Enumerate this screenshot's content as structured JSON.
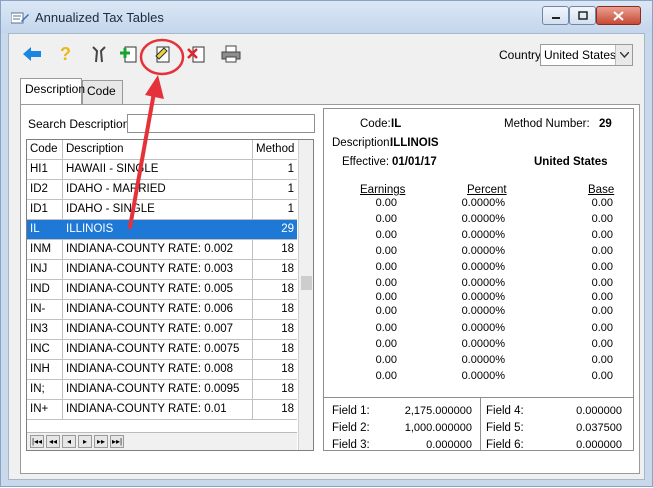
{
  "window": {
    "title": "Annualized Tax Tables"
  },
  "toolbar": {
    "buttons": [
      {
        "name": "back-arrow-icon"
      },
      {
        "name": "help-icon"
      },
      {
        "name": "tools-icon"
      },
      {
        "name": "add-icon"
      },
      {
        "name": "edit-icon"
      },
      {
        "name": "delete-icon"
      },
      {
        "name": "print-icon"
      }
    ],
    "country_label": "Country",
    "country_value": "United States"
  },
  "tabs": [
    {
      "label": "Description"
    },
    {
      "label": "Code"
    }
  ],
  "search": {
    "label": "Search Description",
    "value": ""
  },
  "grid": {
    "headers": [
      "Code",
      "Description",
      "Method"
    ],
    "rows": [
      [
        "HI1",
        "HAWAII - SINGLE",
        "1"
      ],
      [
        "ID2",
        "IDAHO - MARRIED",
        "1"
      ],
      [
        "ID1",
        "IDAHO - SINGLE",
        "1"
      ],
      [
        "IL",
        "ILLINOIS",
        "29"
      ],
      [
        "INM",
        "INDIANA-COUNTY RATE: 0.002",
        "18"
      ],
      [
        "INJ",
        "INDIANA-COUNTY RATE: 0.003",
        "18"
      ],
      [
        "IND",
        "INDIANA-COUNTY RATE: 0.005",
        "18"
      ],
      [
        "IN-",
        "INDIANA-COUNTY RATE: 0.006",
        "18"
      ],
      [
        "IN3",
        "INDIANA-COUNTY RATE: 0.007",
        "18"
      ],
      [
        "INC",
        "INDIANA-COUNTY RATE: 0.0075",
        "18"
      ],
      [
        "INH",
        "INDIANA-COUNTY RATE: 0.008",
        "18"
      ],
      [
        "IN;",
        "INDIANA-COUNTY RATE: 0.0095",
        "18"
      ],
      [
        "IN+",
        "INDIANA-COUNTY RATE: 0.01",
        "18"
      ]
    ],
    "selected_index": 3,
    "nav": [
      "|◂◂",
      "◂◂",
      "◂",
      "▸",
      "▸▸",
      "▸▸|"
    ]
  },
  "detail": {
    "code_label": "Code:",
    "code_value": "IL",
    "method_label": "Method Number:",
    "method_value": "29",
    "desc_label": "Description:",
    "desc_value": "ILLINOIS",
    "eff_label": "Effective:",
    "eff_value": "01/01/17",
    "country_value": "United States",
    "col_headers": [
      "Earnings",
      "Percent",
      "Base"
    ],
    "rows": [
      [
        "0.00",
        "0.0000%",
        "0.00"
      ],
      [
        "0.00",
        "0.0000%",
        "0.00"
      ],
      [
        "0.00",
        "0.0000%",
        "0.00"
      ],
      [
        "0.00",
        "0.0000%",
        "0.00"
      ],
      [
        "0.00",
        "0.0000%",
        "0.00"
      ],
      [
        "0.00",
        "0.0000%",
        "0.00"
      ],
      [
        "0.00",
        "0.0000%",
        "0.00"
      ],
      [
        "0.00",
        "0.0000%",
        "0.00"
      ],
      [
        "0.00",
        "0.0000%",
        "0.00"
      ],
      [
        "0.00",
        "0.0000%",
        "0.00"
      ],
      [
        "0.00",
        "0.0000%",
        "0.00"
      ],
      [
        "0.00",
        "0.0000%",
        "0.00"
      ]
    ],
    "fields": [
      {
        "label": "Field 1:",
        "value": "2,175.000000"
      },
      {
        "label": "Field 2:",
        "value": "1,000.000000"
      },
      {
        "label": "Field 3:",
        "value": "0.000000"
      },
      {
        "label": "Field 4:",
        "value": "0.000000"
      },
      {
        "label": "Field 5:",
        "value": "0.037500"
      },
      {
        "label": "Field 6:",
        "value": "0.000000"
      }
    ]
  },
  "colors": {
    "selection": "#1e78d6",
    "annotation": "#e5323a"
  }
}
